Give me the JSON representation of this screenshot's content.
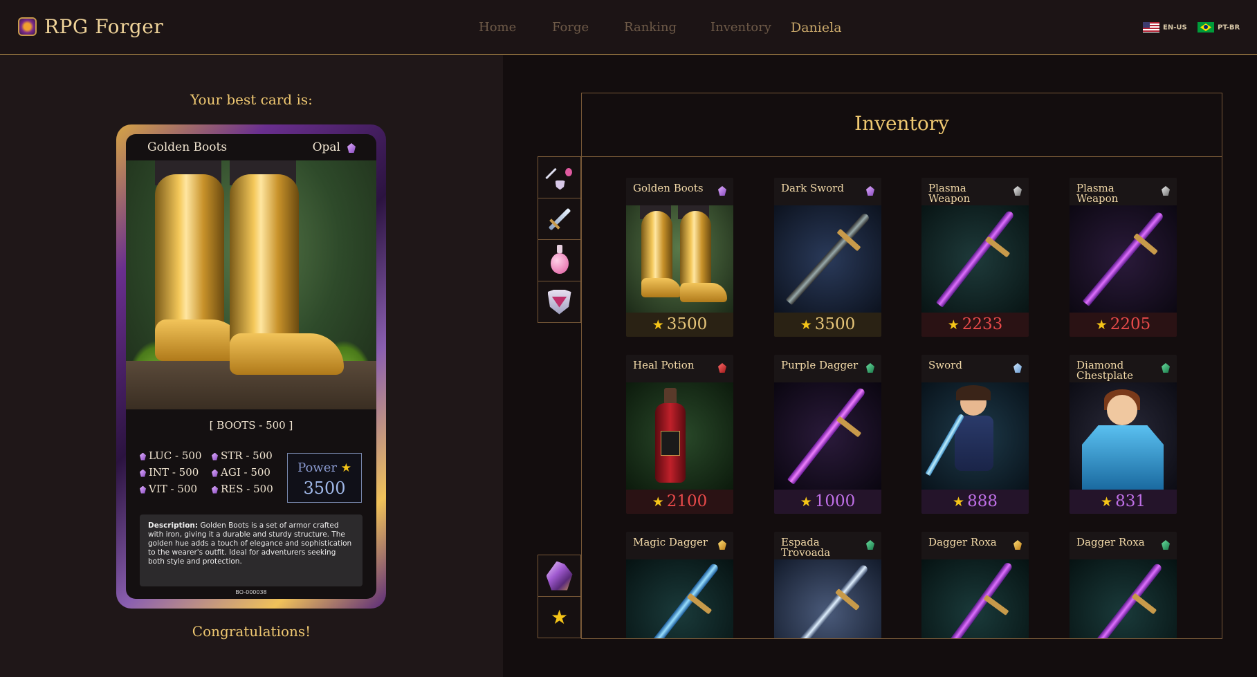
{
  "app": {
    "title": "RPG Forger"
  },
  "nav": {
    "home": "Home",
    "forge": "Forge",
    "ranking": "Ranking",
    "inventory": "Inventory",
    "user": "Daniela"
  },
  "lang": {
    "en": "EN-US",
    "pt": "PT-BR"
  },
  "best": {
    "label": "Your best card is:",
    "congrats": "Congratulations!",
    "card": {
      "name": "Golden Boots",
      "rarity": "Opal",
      "type": "[ BOOTS - 500 ]",
      "stats": {
        "luc": "LUC - 500",
        "str": "STR - 500",
        "int": "INT - 500",
        "agi": "AGI - 500",
        "vit": "VIT - 500",
        "res": "RES - 500"
      },
      "power_label": "Power",
      "power": "3500",
      "desc_label": "Description:",
      "description": "Golden Boots is a set of armor crafted with iron, giving it a durable and sturdy structure. The golden hue adds a touch of elegance and sophistication to the wearer's outfit. Ideal for adventurers seeking both style and protection.",
      "code": "BO-000038"
    }
  },
  "inventory": {
    "title": "Inventory",
    "cards": [
      {
        "name": "Golden Boots",
        "power": "3500",
        "gem": "purple",
        "foot_color": "#e8c77a",
        "foot_bg": "#2a2214"
      },
      {
        "name": "Dark Sword",
        "power": "3500",
        "gem": "purple",
        "foot_color": "#e8c77a",
        "foot_bg": "#2a2214"
      },
      {
        "name": "Plasma Weapon",
        "power": "2233",
        "gem": "silver",
        "foot_color": "#e84a4a",
        "foot_bg": "#2a1214"
      },
      {
        "name": "Plasma Weapon",
        "power": "2205",
        "gem": "silver",
        "foot_color": "#e84a4a",
        "foot_bg": "#2a1214"
      },
      {
        "name": "Heal Potion",
        "power": "2100",
        "gem": "red",
        "foot_color": "#e84a4a",
        "foot_bg": "#2a1214"
      },
      {
        "name": "Purple Dagger",
        "power": "1000",
        "gem": "green",
        "foot_color": "#c070e8",
        "foot_bg": "#24142a"
      },
      {
        "name": "Sword",
        "power": "888",
        "gem": "blue",
        "foot_color": "#c070e8",
        "foot_bg": "#24142a"
      },
      {
        "name": "Diamond Chestplate",
        "power": "831",
        "gem": "green",
        "foot_color": "#c070e8",
        "foot_bg": "#24142a"
      },
      {
        "name": "Magic Dagger",
        "power": "",
        "gem": "gold",
        "foot_color": "#e8c77a",
        "foot_bg": "#2a2214"
      },
      {
        "name": "Espada Trovoada",
        "power": "",
        "gem": "green",
        "foot_color": "#e8c77a",
        "foot_bg": "#2a2214"
      },
      {
        "name": "Dagger Roxa",
        "power": "",
        "gem": "gold",
        "foot_color": "#e8c77a",
        "foot_bg": "#2a2214"
      },
      {
        "name": "Dagger Roxa",
        "power": "",
        "gem": "green",
        "foot_color": "#e8c77a",
        "foot_bg": "#2a2214"
      }
    ]
  }
}
